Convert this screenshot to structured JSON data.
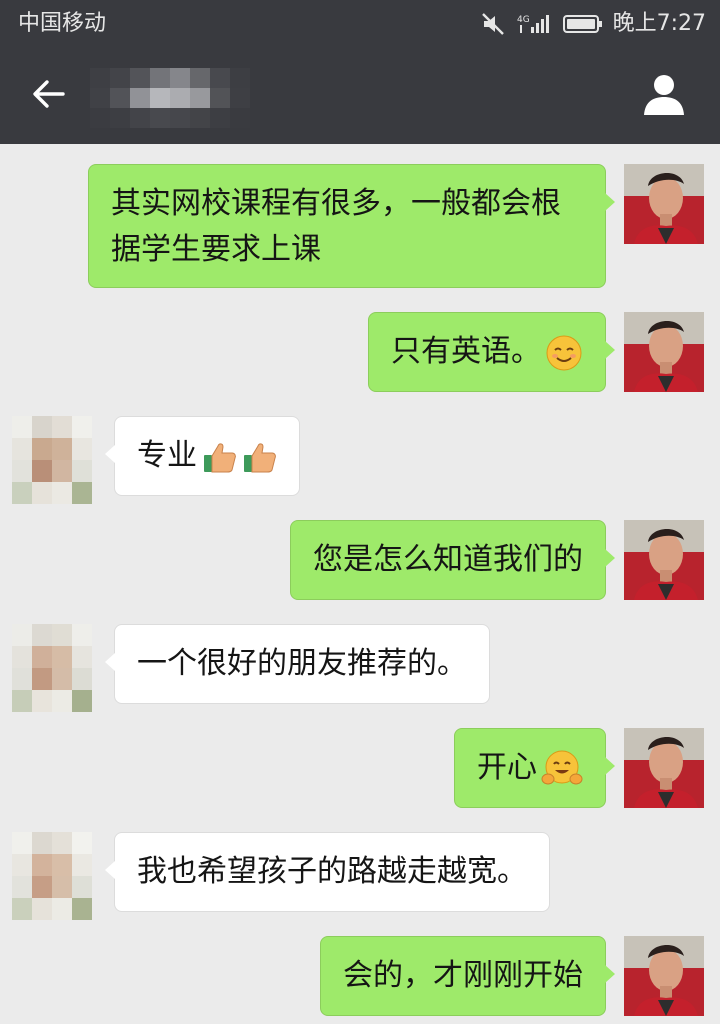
{
  "status_bar": {
    "carrier": "中国移动",
    "network": "4G",
    "time": "晚上7:27"
  },
  "header": {
    "title": "",
    "back_icon": "back-arrow-icon",
    "profile_icon": "person-icon"
  },
  "messages": [
    {
      "side": "sent",
      "text": "其实网校课程有很多，一般都会根据学生要求上课",
      "emoji": []
    },
    {
      "side": "sent",
      "text": "只有英语。",
      "emoji": [
        "smiling-face-emoji"
      ]
    },
    {
      "side": "received",
      "text": "专业",
      "emoji": [
        "thumbs-up-emoji",
        "thumbs-up-emoji"
      ]
    },
    {
      "side": "sent",
      "text": "您是怎么知道我们的",
      "emoji": []
    },
    {
      "side": "received",
      "text": "一个很好的朋友推荐的。",
      "emoji": []
    },
    {
      "side": "sent",
      "text": "开心",
      "emoji": [
        "hugging-face-emoji"
      ]
    },
    {
      "side": "received",
      "text": "我也希望孩子的路越走越宽。",
      "emoji": []
    },
    {
      "side": "sent",
      "text": "会的，才刚刚开始",
      "emoji": []
    }
  ],
  "colors": {
    "bar": "#393a3f",
    "sent_bubble": "#9eea6a",
    "received_bubble": "#ffffff",
    "background": "#ebebeb"
  }
}
